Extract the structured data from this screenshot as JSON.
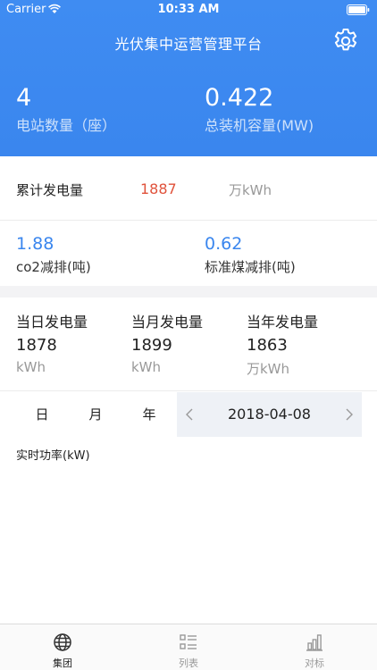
{
  "status_bar": {
    "carrier": "Carrier",
    "time": "10:33 AM"
  },
  "header": {
    "title": "光伏集中运营管理平台",
    "stats": [
      {
        "value": "4",
        "label": "电站数量（座）"
      },
      {
        "value": "0.422",
        "label": "总装机容量(MW)"
      }
    ]
  },
  "cumulative": {
    "label": "累计发电量",
    "value": "1887",
    "unit": "万kWh",
    "value_color": "#e0523b"
  },
  "emissions": [
    {
      "value": "1.88",
      "label": "co2减排(吨)"
    },
    {
      "value": "0.62",
      "label": "标准煤减排(吨)"
    }
  ],
  "generation": [
    {
      "label": "当日发电量",
      "value": "1878",
      "unit": "kWh"
    },
    {
      "label": "当月发电量",
      "value": "1899",
      "unit": "kWh"
    },
    {
      "label": "当年发电量",
      "value": "1863",
      "unit": "万kWh"
    }
  ],
  "period_tabs": [
    {
      "label": "日",
      "active": true
    },
    {
      "label": "月",
      "active": false
    },
    {
      "label": "年",
      "active": false
    }
  ],
  "date_picker": {
    "value": "2018-04-08"
  },
  "chart": {
    "title": "实时功率(kW)"
  },
  "tabbar": [
    {
      "label": "集团",
      "icon": "globe-icon",
      "active": true
    },
    {
      "label": "列表",
      "icon": "list-icon",
      "active": false
    },
    {
      "label": "对标",
      "icon": "bar-chart-icon",
      "active": false
    }
  ],
  "colors": {
    "brand": "#3a86ee",
    "accent_red": "#e0523b"
  }
}
